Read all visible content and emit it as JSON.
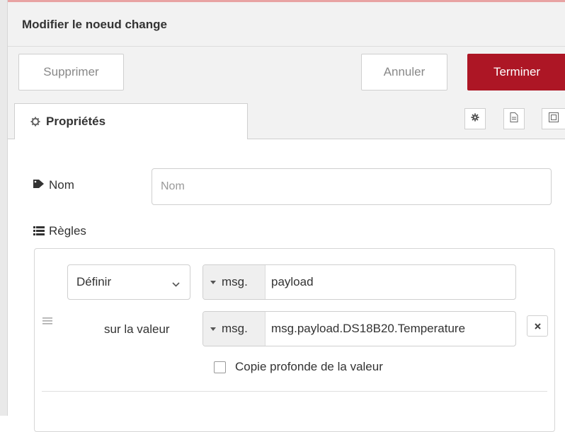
{
  "dialog": {
    "title": "Modifier le noeud change"
  },
  "toolbar": {
    "delete_label": "Supprimer",
    "cancel_label": "Annuler",
    "done_label": "Terminer"
  },
  "tabs": {
    "properties_label": "Propriétés",
    "icons": [
      "gear-icon",
      "document-icon",
      "frame-icon"
    ]
  },
  "form": {
    "name_label": "Nom",
    "name_value": "",
    "name_placeholder": "Nom",
    "rules_label": "Règles"
  },
  "rule": {
    "action": "Définir",
    "target_type": "msg.",
    "target_value": "payload",
    "value_label": "sur la valeur",
    "value_type": "msg.",
    "value_value": "msg.payload.DS18B20.Temperature",
    "deep_copy_label": "Copie profonde de la valeur",
    "deep_copy_checked": false
  },
  "colors": {
    "accent": "#ad1625",
    "header_bg": "#f2f2f2"
  }
}
